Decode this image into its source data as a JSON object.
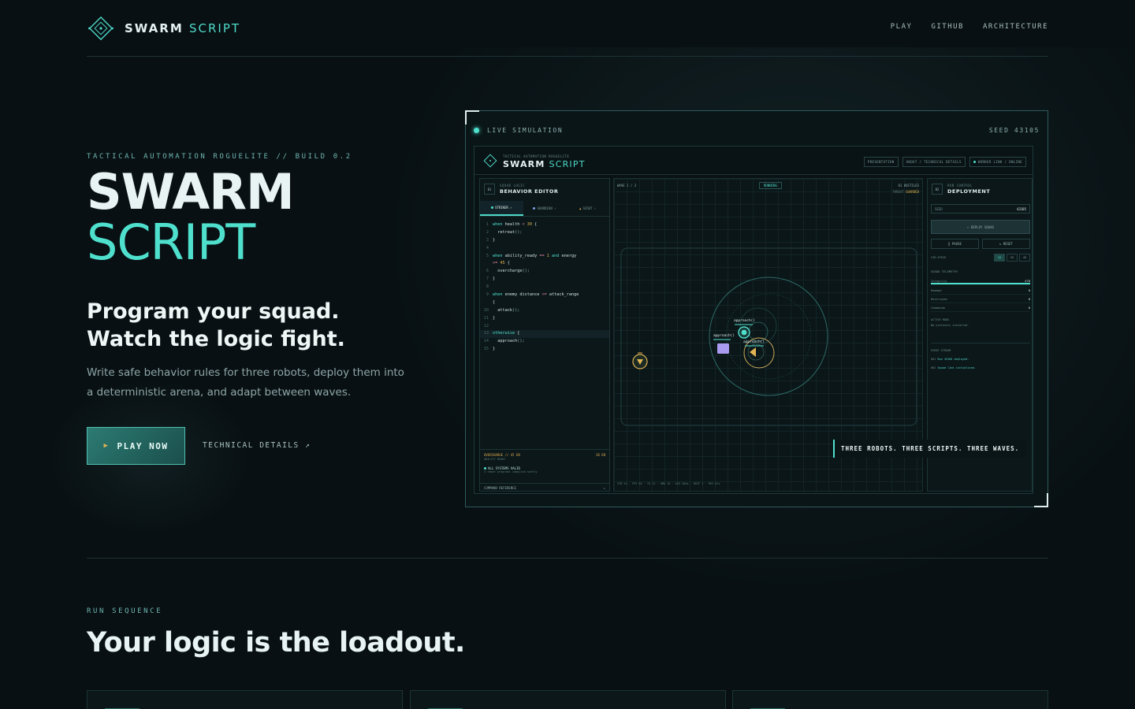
{
  "nav": {
    "brand_primary": "SWARM",
    "brand_accent": "SCRIPT",
    "links": [
      "PLAY",
      "GITHUB",
      "ARCHITECTURE"
    ]
  },
  "hero": {
    "eyebrow": "TACTICAL AUTOMATION ROGUELITE // BUILD 0.2",
    "title_line1": "SWARM",
    "title_line2": "SCRIPT",
    "tagline": "Program your squad. Watch the logic fight.",
    "description": "Write safe behavior rules for three robots, deploy them into a deterministic arena, and adapt between waves.",
    "play_label": "PLAY NOW",
    "tech_link": "TECHNICAL DETAILS ↗"
  },
  "preview": {
    "live_label": "LIVE SIMULATION",
    "seed_label": "SEED 43105",
    "banner": "THREE ROBOTS. THREE SCRIPTS. THREE WAVES.",
    "app": {
      "sub": "TACTICAL AUTOMATION ROGUELITE",
      "title_primary": "SWARM",
      "title_accent": "SCRIPT",
      "nav": [
        "PRESENTATION",
        "ABOUT / TECHNICAL DETAILS",
        "WORKER LINK / ONLINE"
      ]
    },
    "editor": {
      "badge": "01",
      "sub": "SQUAD LOGIC",
      "title": "BEHAVIOR EDITOR",
      "tabs": [
        "STRIKER ✓",
        "GUARDIAN ✓",
        "SCOUT ✓"
      ],
      "footer_left": "OVERCHARGE // 45 EN",
      "footer_sub": "ABILITY READY",
      "footer_right": "28 EN",
      "valid": "ALL SYSTEMS VALID",
      "valid_sub": "3 robot programs compiled safely",
      "reference": "COMMAND REFERENCE",
      "reference_arrow": "▸"
    },
    "arena": {
      "wave": "WAVE 1 / 3",
      "status": "RUNNING",
      "hostiles": "01 HOSTILES",
      "threat_label": "THREAT",
      "threat_value": "GUARDED",
      "approach_labels": [
        "approach()",
        "approach()",
        "approach()"
      ],
      "footer": "SIM 1x · FPS 60 · TK 12 · HMA 10 · AX3 28ms · DRIF 1 · MVS 0/s"
    },
    "deploy": {
      "badge": "02",
      "sub": "RUN CONTROL",
      "title": "DEPLOYMENT",
      "seed_label": "SEED",
      "seed_value": "43105",
      "deploy_btn": "← DEPLOY SQUAD",
      "pause": "‖ PAUSE",
      "reset": "↻ RESET",
      "speed_label": "SIM SPEED",
      "speed_opts": [
        "1X",
        "2X",
        "4X"
      ],
      "telemetry_header": "SQUAD TELEMETRY",
      "telemetry": [
        {
          "label": "Integrity",
          "value": "478"
        },
        {
          "label": "Damage",
          "value": "0"
        },
        {
          "label": "Destroyed",
          "value": "0"
        },
        {
          "label": "Commands",
          "value": "0"
        }
      ],
      "modes_header": "ACTIVE MODS",
      "modes_value": "No protocols installed.",
      "stream_header": "EVENT STREAM",
      "events": [
        {
          "code": "001",
          "text": "Run 43105 deployed."
        },
        {
          "code": "002",
          "text": "Squad link initialized."
        }
      ]
    },
    "code_lines": [
      {
        "n": "1",
        "parts": [
          [
            "kw",
            "when "
          ],
          [
            "",
            "health "
          ],
          [
            "op",
            "< "
          ],
          [
            "num",
            "30"
          ],
          [
            "",
            " {"
          ]
        ]
      },
      {
        "n": "2",
        "parts": [
          [
            "",
            "  retreat"
          ],
          [
            "fn",
            "();"
          ]
        ]
      },
      {
        "n": "3",
        "parts": [
          [
            "",
            "}"
          ]
        ]
      },
      {
        "n": "4",
        "parts": []
      },
      {
        "n": "5",
        "parts": [
          [
            "kw",
            "when "
          ],
          [
            "",
            "ability_ready "
          ],
          [
            "op",
            "== "
          ],
          [
            "num",
            "1"
          ],
          [
            "kw",
            " and "
          ],
          [
            "",
            "energy"
          ]
        ]
      },
      {
        "n": "",
        "parts": [
          [
            "op",
            ">= "
          ],
          [
            "num",
            "45"
          ],
          [
            "",
            " {"
          ]
        ]
      },
      {
        "n": "6",
        "parts": [
          [
            "",
            "  overcharge"
          ],
          [
            "fn",
            "();"
          ]
        ]
      },
      {
        "n": "7",
        "parts": [
          [
            "",
            "}"
          ]
        ]
      },
      {
        "n": "8",
        "parts": []
      },
      {
        "n": "9",
        "parts": [
          [
            "kw",
            "when "
          ],
          [
            "",
            "enemy distance "
          ],
          [
            "op",
            "<= "
          ],
          [
            "",
            "attack_range"
          ]
        ]
      },
      {
        "n": "",
        "parts": [
          [
            "",
            "{"
          ]
        ]
      },
      {
        "n": "10",
        "parts": [
          [
            "",
            "  attack"
          ],
          [
            "fn",
            "();"
          ]
        ]
      },
      {
        "n": "11",
        "parts": [
          [
            "",
            "}"
          ]
        ]
      },
      {
        "n": "12",
        "parts": []
      },
      {
        "n": "13",
        "parts": [
          [
            "kw",
            "otherwise"
          ],
          [
            "",
            " {"
          ]
        ]
      },
      {
        "n": "14",
        "parts": [
          [
            "",
            "  approach"
          ],
          [
            "fn",
            "();"
          ]
        ]
      },
      {
        "n": "15",
        "parts": [
          [
            "",
            "}"
          ]
        ]
      }
    ]
  },
  "run": {
    "eyebrow": "RUN SEQUENCE",
    "title": "Your logic is the loadout."
  },
  "colors": {
    "accent": "#4fe0cd",
    "warning": "#e0b354",
    "background": "#081013",
    "enemy": "#a99cf0"
  }
}
